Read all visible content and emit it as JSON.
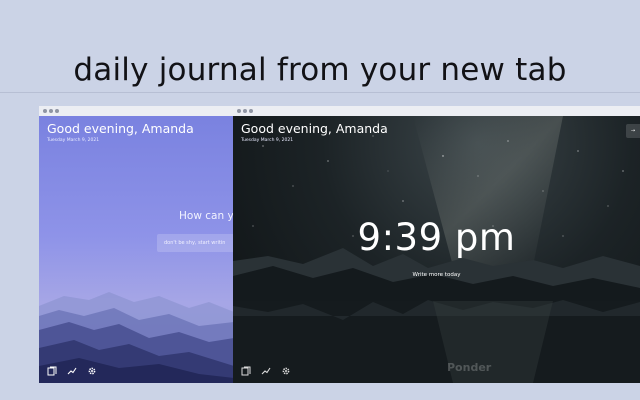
{
  "headline": "daily journal from your new tab",
  "left_tab": {
    "greeting": "Good evening, Amanda",
    "date": "Tuesday March 9, 2021",
    "prompt": "How can you",
    "input_placeholder": "don't be shy, start writin"
  },
  "right_tab": {
    "greeting": "Good evening, Amanda",
    "date": "Tuesday March 9, 2021",
    "clock": "9:39 pm",
    "write_link": "Write more today",
    "brand": "Ponder",
    "corner_button": "→"
  },
  "toolbar_icons": [
    "journal-icon",
    "stats-icon",
    "settings-icon"
  ],
  "colors": {
    "page_background": "#cbd3e6",
    "left_tab_sky": "#7a82e0",
    "right_tab_sky": "#1c2326"
  }
}
